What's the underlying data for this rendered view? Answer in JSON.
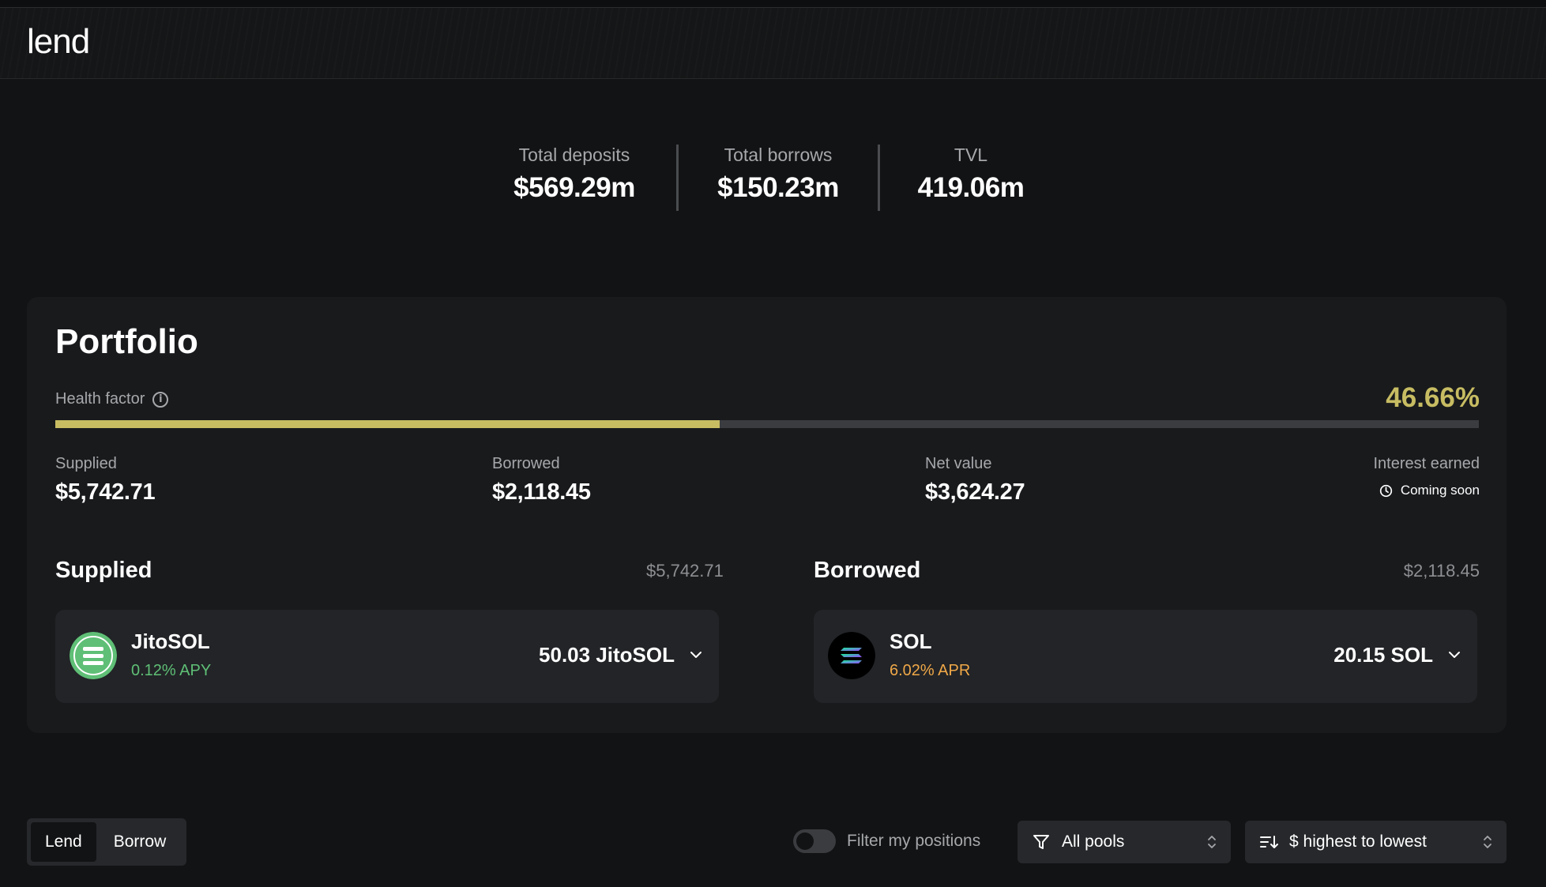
{
  "app": {
    "logo": "lend"
  },
  "stats": [
    {
      "label": "Total deposits",
      "value": "$569.29m"
    },
    {
      "label": "Total borrows",
      "value": "$150.23m"
    },
    {
      "label": "TVL",
      "value": "419.06m"
    }
  ],
  "portfolio": {
    "title": "Portfolio",
    "health_factor_label": "Health factor",
    "health_factor_value": "46.66%",
    "health_factor_fraction": 0.4666,
    "metrics": {
      "supplied": {
        "label": "Supplied",
        "value": "$5,742.71"
      },
      "borrowed": {
        "label": "Borrowed",
        "value": "$2,118.45"
      },
      "net_value": {
        "label": "Net value",
        "value": "$3,624.27"
      },
      "interest": {
        "label": "Interest earned",
        "status": "Coming soon"
      }
    },
    "supplied_section": {
      "title": "Supplied",
      "total": "$5,742.71",
      "asset": {
        "name": "JitoSOL",
        "rate": "0.12% APY",
        "amount": "50.03 JitoSOL",
        "rate_color": "#5fbf76"
      }
    },
    "borrowed_section": {
      "title": "Borrowed",
      "total": "$2,118.45",
      "asset": {
        "name": "SOL",
        "rate": "6.02% APR",
        "amount": "20.15 SOL",
        "rate_color": "#f0a848"
      }
    }
  },
  "controls": {
    "tabs": [
      {
        "label": "Lend",
        "active": true
      },
      {
        "label": "Borrow",
        "active": false
      }
    ],
    "filter_label": "Filter my positions",
    "pool_select": "All pools",
    "sort_select": "$ highest to lowest"
  },
  "colors": {
    "health_accent": "#c7bc62",
    "background": "#121314",
    "card": "#181a1c"
  }
}
